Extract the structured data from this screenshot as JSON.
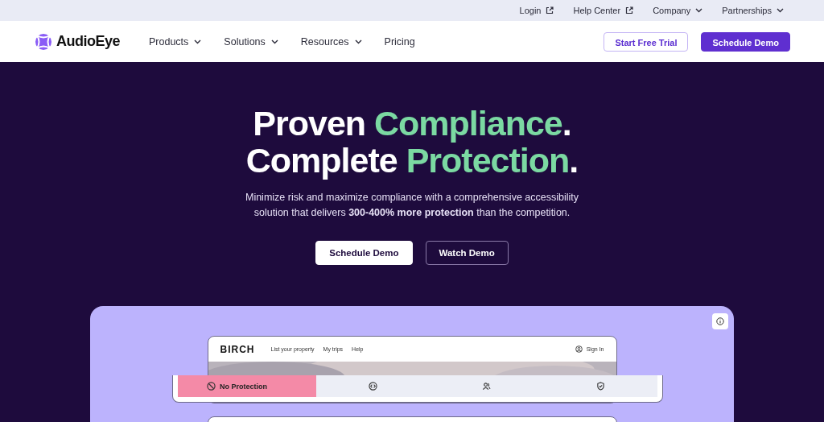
{
  "utility_bar": [
    {
      "label": "Login",
      "kind": "external"
    },
    {
      "label": "Help Center",
      "kind": "external"
    },
    {
      "label": "Company",
      "kind": "dropdown"
    },
    {
      "label": "Partnerships",
      "kind": "dropdown"
    }
  ],
  "nav": {
    "brand": "AudioEye",
    "items": [
      {
        "label": "Products",
        "kind": "dropdown"
      },
      {
        "label": "Solutions",
        "kind": "dropdown"
      },
      {
        "label": "Resources",
        "kind": "dropdown"
      },
      {
        "label": "Pricing",
        "kind": "link"
      }
    ],
    "buttons": [
      {
        "label": "Start Free Trial",
        "kind": "outline"
      },
      {
        "label": "Schedule Demo",
        "kind": "primary"
      }
    ]
  },
  "hero": {
    "headline": [
      [
        {
          "text": "Proven ",
          "accent": false
        },
        {
          "text": "Compliance",
          "accent": true
        },
        {
          "text": ".",
          "accent": false
        }
      ],
      [
        {
          "text": "Complete ",
          "accent": false
        },
        {
          "text": "Protection",
          "accent": true
        },
        {
          "text": ".",
          "accent": false
        }
      ]
    ],
    "subtitle": "Minimize risk and maximize compliance with a comprehensive accessibility solution that delivers **300-400% more protection** than the competition.",
    "buttons": [
      {
        "label": "Schedule Demo",
        "kind": "light"
      },
      {
        "label": "Watch Demo",
        "kind": "outline"
      }
    ]
  },
  "showcase": {
    "mock_site": {
      "brand": "BIRCH",
      "links": [
        "List your property",
        "My trips",
        "Help"
      ],
      "sign_in": "Sign In"
    },
    "modes": [
      {
        "label": "No Protection",
        "kind": "ban",
        "selected": true
      },
      {
        "kind": "code",
        "selected": false
      },
      {
        "kind": "people",
        "selected": false
      },
      {
        "kind": "shield",
        "selected": false
      }
    ]
  }
}
